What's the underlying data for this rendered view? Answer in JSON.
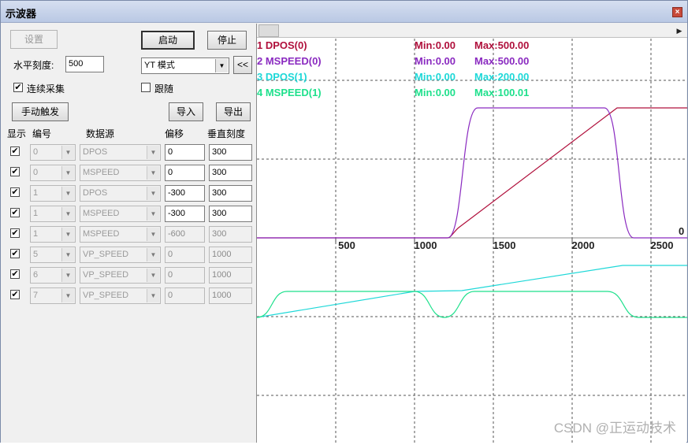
{
  "window": {
    "title": "示波器",
    "close": "×"
  },
  "toolbar": {
    "settings": "设置",
    "start": "启动",
    "stop": "停止",
    "h_scale_label": "水平刻度:",
    "h_scale_value": "500",
    "mode_value": "YT 模式",
    "collapse": "<<",
    "continuous_label": "连续采集",
    "continuous_checked": true,
    "follow_label": "跟随",
    "follow_checked": false,
    "manual_trigger": "手动触发",
    "import": "导入",
    "export": "导出"
  },
  "grid_header": {
    "show": "显示",
    "num": "编号",
    "source": "数据源",
    "offset": "偏移",
    "vscale": "垂直刻度"
  },
  "channels": [
    {
      "show": true,
      "num": "0",
      "source": "DPOS",
      "offset": "0",
      "vscale": "300",
      "enabled": true
    },
    {
      "show": true,
      "num": "0",
      "source": "MSPEED",
      "offset": "0",
      "vscale": "300",
      "enabled": true
    },
    {
      "show": true,
      "num": "1",
      "source": "DPOS",
      "offset": "-300",
      "vscale": "300",
      "enabled": true
    },
    {
      "show": true,
      "num": "1",
      "source": "MSPEED",
      "offset": "-300",
      "vscale": "300",
      "enabled": true
    },
    {
      "show": true,
      "num": "1",
      "source": "MSPEED",
      "offset": "-600",
      "vscale": "300",
      "enabled": false
    },
    {
      "show": true,
      "num": "5",
      "source": "VP_SPEED",
      "offset": "0",
      "vscale": "1000",
      "enabled": false
    },
    {
      "show": true,
      "num": "6",
      "source": "VP_SPEED",
      "offset": "0",
      "vscale": "1000",
      "enabled": false
    },
    {
      "show": true,
      "num": "7",
      "source": "VP_SPEED",
      "offset": "0",
      "vscale": "1000",
      "enabled": false
    }
  ],
  "legend": [
    {
      "name": "1 DPOS(0)",
      "min": "Min:0.00",
      "max": "Max:500.00",
      "color": "#b0103c"
    },
    {
      "name": "2 MSPEED(0)",
      "min": "Min:0.00",
      "max": "Max:500.00",
      "color": "#8a2ac0"
    },
    {
      "name": "3 DPOS(1)",
      "min": "Min:0.00",
      "max": "Max:200.00",
      "color": "#1ed8d8"
    },
    {
      "name": "4 MSPEED(1)",
      "min": "Min:0.00",
      "max": "Max:100.01",
      "color": "#1ee08c"
    }
  ],
  "axis": {
    "ticks": [
      "500",
      "1000",
      "1500",
      "2000",
      "2500"
    ],
    "zero_label": "0"
  },
  "watermark": "CSDN @正运动技术"
}
